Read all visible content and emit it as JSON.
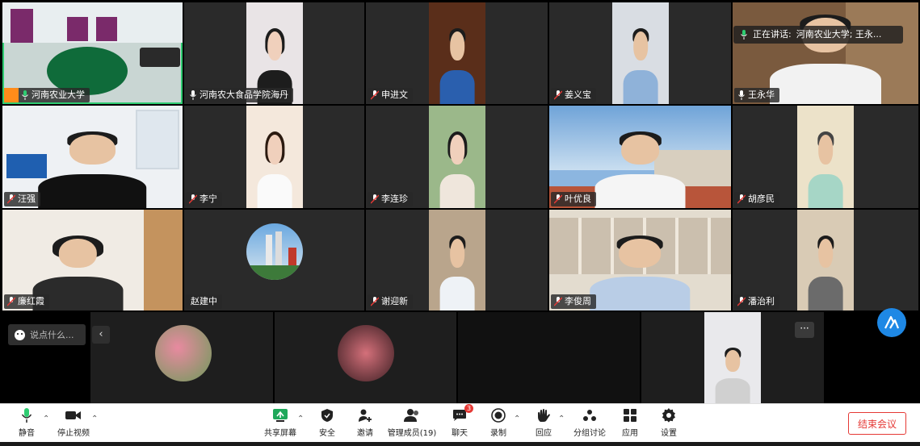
{
  "speaking": {
    "prefix": "正在讲话:",
    "names": "河南农业大学; 王永..."
  },
  "tiles": {
    "t1": "河南农业大学",
    "t2": "河南农大食品学院海丹",
    "t3": "申进文",
    "t4": "姜义宝",
    "t5": "王永华",
    "t6": "汪强",
    "t7": "李宁",
    "t8": "李连珍",
    "t9": "叶优良",
    "t10": "胡彦民",
    "t11": "廉红霞",
    "t12": "赵建中",
    "t13": "谢迎新",
    "t14": "李俊周",
    "t15": "潘治利"
  },
  "chat": {
    "placeholder": "说点什么..."
  },
  "toolbar": {
    "mute": "静音",
    "stop_video": "停止视频",
    "share": "共享屏幕",
    "security": "安全",
    "invite": "邀请",
    "members": "管理成员(19)",
    "chat": "聊天",
    "chat_badge": "3",
    "record": "录制",
    "reactions": "回应",
    "breakout": "分组讨论",
    "apps": "应用",
    "settings": "设置",
    "end": "结束会议"
  },
  "colors": {
    "accent": "#1e88e5",
    "end": "#e53935",
    "active": "#2ecc71"
  }
}
